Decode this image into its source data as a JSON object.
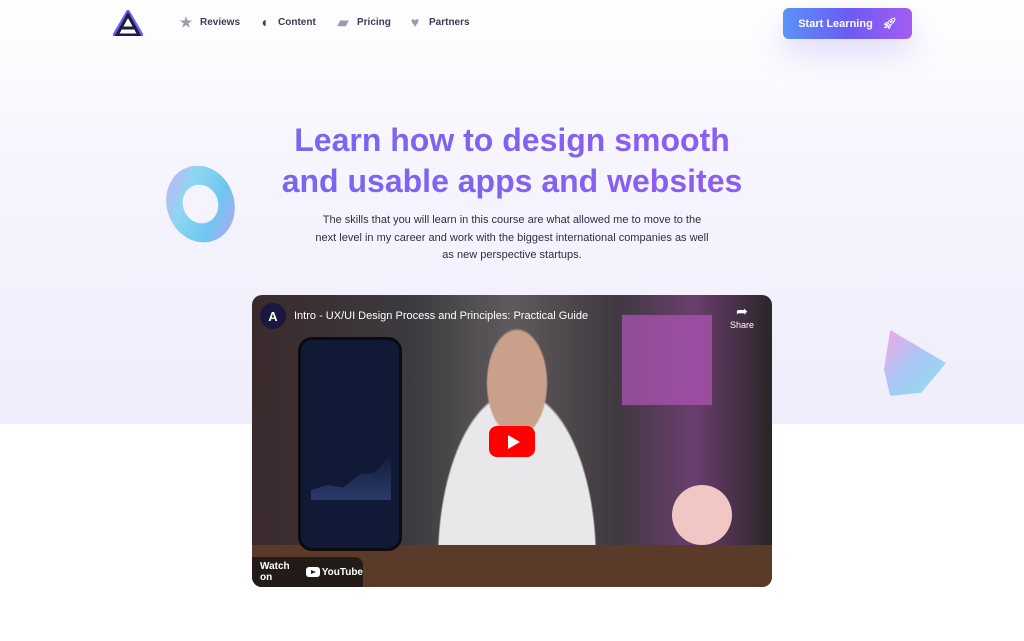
{
  "nav": {
    "items": [
      {
        "label": "Reviews",
        "icon": "star-icon"
      },
      {
        "label": "Content",
        "icon": "content-icon"
      },
      {
        "label": "Pricing",
        "icon": "wallet-icon"
      },
      {
        "label": "Partners",
        "icon": "heart-icon"
      }
    ],
    "cta": "Start Learning"
  },
  "hero": {
    "title_line1": "Learn how to design smooth",
    "title_line2": "and usable apps and websites",
    "subtitle": "The skills that you will learn in this course are what allowed me to move to the next level in my career and work with the biggest international companies as well as new perspective startups."
  },
  "video": {
    "title": "Intro - UX/UI Design Process and Principles: Practical Guide",
    "share": "Share",
    "watch_on": "Watch on",
    "youtube": "YouTube"
  },
  "colors": {
    "accent_start": "#5b93f7",
    "accent_end": "#a45cf0",
    "youtube_red": "#ff0000"
  }
}
